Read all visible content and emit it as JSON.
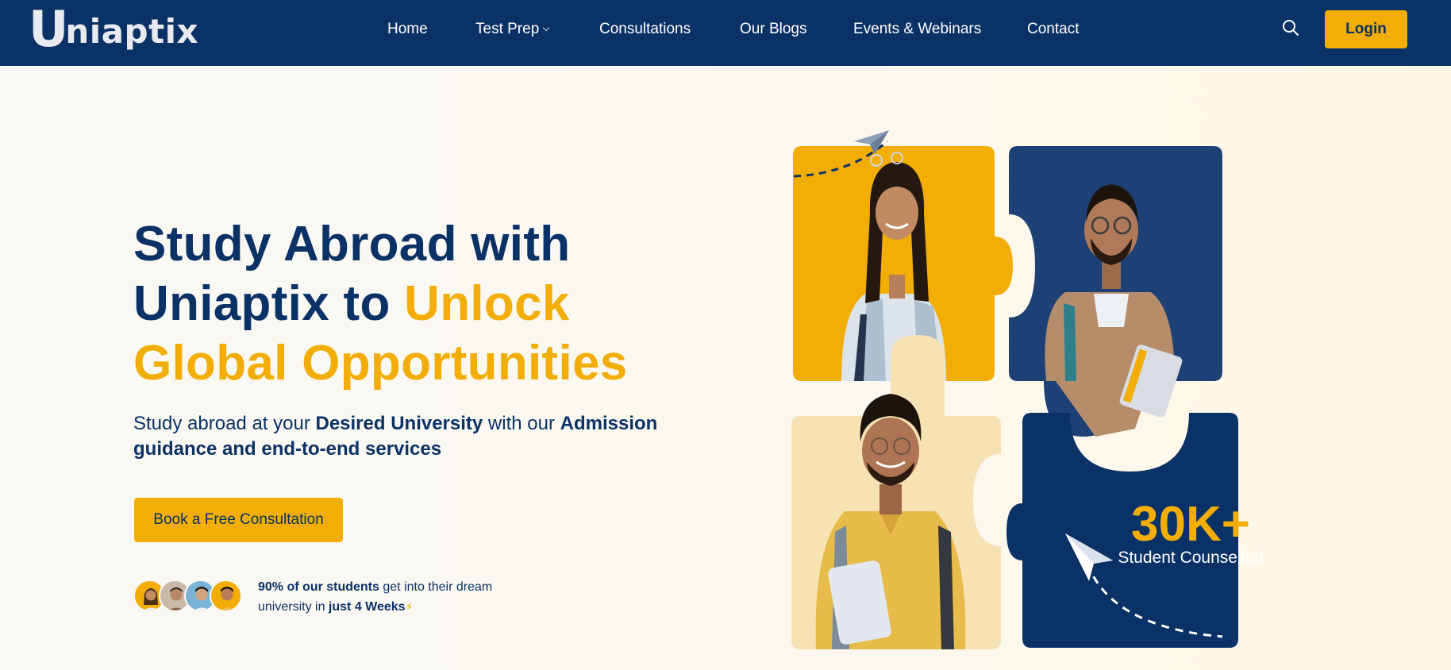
{
  "brand": {
    "logo_first": "U",
    "logo_rest": "niaptix",
    "accent": "#f2ae06",
    "navy": "#0b3266"
  },
  "nav": {
    "items": [
      {
        "label": "Home"
      },
      {
        "label": "Test Prep",
        "has_dropdown": true
      },
      {
        "label": "Consultations"
      },
      {
        "label": "Our Blogs"
      },
      {
        "label": "Events & Webinars"
      },
      {
        "label": "Contact"
      }
    ],
    "search_icon": "search-icon",
    "login_label": "Login"
  },
  "hero": {
    "headline_part1": "Study Abroad with Uniaptix to ",
    "headline_accent": "Unlock Global Opportunities",
    "sub_prefix": "Study abroad at your ",
    "sub_bold1": "Desired University",
    "sub_mid": " with our ",
    "sub_bold2": "Admission guidance and end-to-end services",
    "cta_label": "Book a Free Consultation",
    "proof_bold1": "90% of our students",
    "proof_mid": " get into their dream university in ",
    "proof_bold2": "just 4 Weeks",
    "proof_icon": "lightning-icon"
  },
  "stat": {
    "number": "30K+",
    "label": "Student Counselled"
  }
}
